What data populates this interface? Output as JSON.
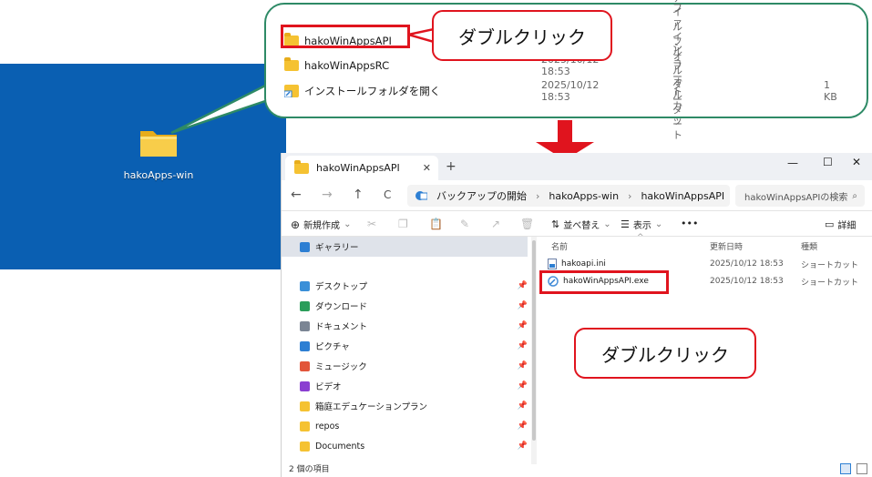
{
  "desktop": {
    "icon_label": "hakoApps-win"
  },
  "top_list": {
    "rows": [
      {
        "name": "hakoWinAppsAPI",
        "date": "",
        "type": "ファイル フォルダー",
        "size": ""
      },
      {
        "name": "hakoWinAppsRC",
        "date": "2025/10/12 18:53",
        "type": "ファイル フォルダー",
        "size": ""
      },
      {
        "name": "インストールフォルダを開く",
        "date": "2025/10/12 18:53",
        "type": "ショートカット",
        "size": "1 KB"
      }
    ]
  },
  "callouts": {
    "top": "ダブルクリック",
    "bottom": "ダブルクリック"
  },
  "explorer": {
    "tab_title": "hakoWinAppsAPI",
    "window_controls": {
      "minimize": "—",
      "maximize": "☐",
      "close": "✕"
    },
    "nav": {
      "back": "←",
      "forward": "→",
      "up": "↑",
      "refresh": "C"
    },
    "breadcrumb": [
      "バックアップの開始",
      "hakoApps-win",
      "hakoWinAppsAPI"
    ],
    "search_placeholder": "hakoWinAppsAPIの検索",
    "commands": {
      "new": "新規作成",
      "sort": "並べ替え",
      "view": "表示",
      "more": "•••",
      "details": "詳細"
    },
    "navpane": {
      "gallery": "ギャラリー",
      "items": [
        {
          "label": "デスクトップ",
          "color": "#3a8fd8"
        },
        {
          "label": "ダウンロード",
          "color": "#2a9d5a"
        },
        {
          "label": "ドキュメント",
          "color": "#7b8594"
        },
        {
          "label": "ピクチャ",
          "color": "#2d7fd3"
        },
        {
          "label": "ミュージック",
          "color": "#e2553a"
        },
        {
          "label": "ビデオ",
          "color": "#8a3fd1"
        },
        {
          "label": "箱庭エデュケーションプラン",
          "color": "#f5c232"
        },
        {
          "label": "repos",
          "color": "#f5c232"
        },
        {
          "label": "Documents",
          "color": "#f5c232"
        }
      ]
    },
    "columns": {
      "name": "名前",
      "date": "更新日時",
      "type": "種類"
    },
    "files": [
      {
        "name": "hakoapi.ini",
        "date": "2025/10/12 18:53",
        "type": "ショートカット"
      },
      {
        "name": "hakoWinAppsAPI.exe",
        "date": "2025/10/12 18:53",
        "type": "ショートカット"
      }
    ],
    "status": "2 個の項目"
  },
  "colors": {
    "desktop": "#0a5fb2",
    "callout_border": "#2e8a66",
    "highlight": "#e0141e",
    "arrow": "#e0141e"
  }
}
